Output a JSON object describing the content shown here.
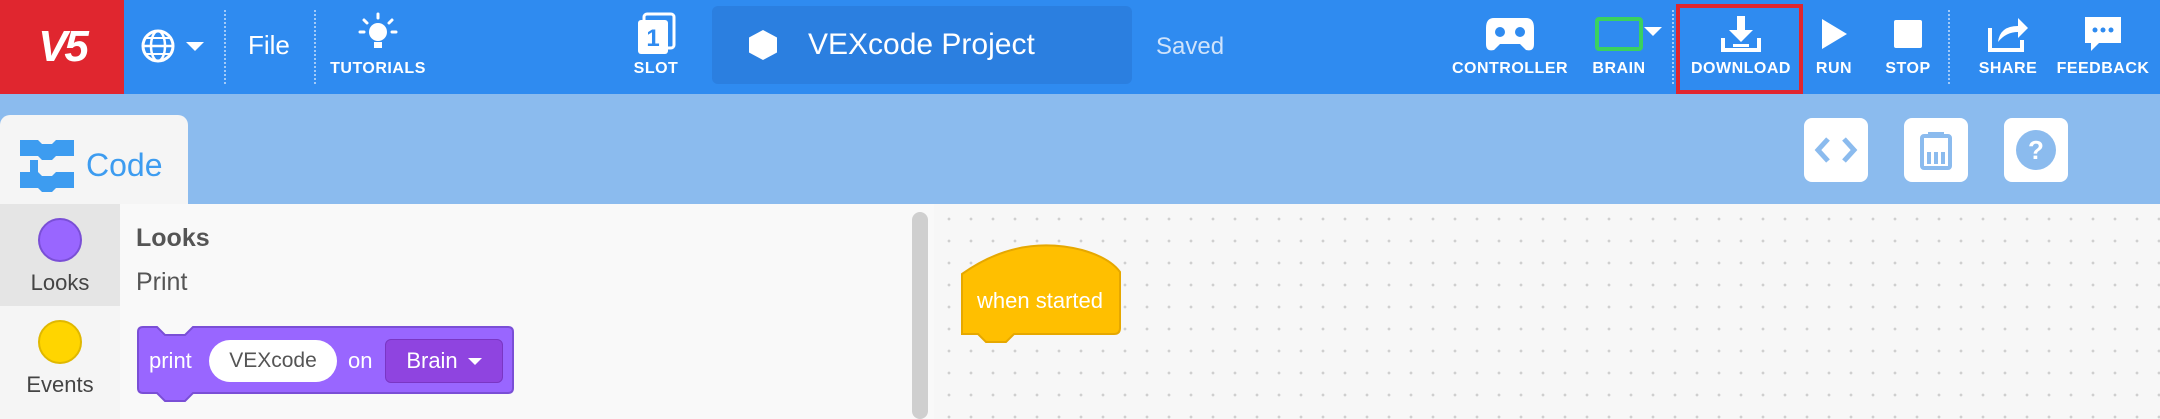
{
  "header": {
    "logo_text": "V5",
    "file_label": "File",
    "tutorials_label": "TUTORIALS",
    "slot_label": "SLOT",
    "slot_number": "1",
    "project_name": "VEXcode Project",
    "status": "Saved",
    "controller_label": "CONTROLLER",
    "brain_label": "BRAIN",
    "download_label": "DOWNLOAD",
    "run_label": "RUN",
    "stop_label": "STOP",
    "share_label": "SHARE",
    "feedback_label": "FEEDBACK"
  },
  "code_tab": {
    "label": "Code"
  },
  "categories": [
    {
      "label": "Looks",
      "color": "#9966ff"
    },
    {
      "label": "Events",
      "color": "#ffd500"
    }
  ],
  "palette": {
    "title": "Looks",
    "subtitle": "Print",
    "print_block": {
      "print": "print",
      "value": "VEXcode",
      "on": "on",
      "device": "Brain"
    }
  },
  "workspace": {
    "hat_block": "when started"
  },
  "colors": {
    "topbar": "#2f8bf0",
    "logo": "#e0262f",
    "band": "#8bbbee",
    "looks_block": "#9966ff",
    "events_block": "#ffbf00",
    "highlight": "#e0262f"
  },
  "icons": [
    "globe-icon",
    "lightbulb-icon",
    "slot-icon",
    "hexagon-icon",
    "controller-icon",
    "brain-icon",
    "download-icon",
    "run-icon",
    "stop-icon",
    "share-icon",
    "feedback-icon",
    "code-blocks-icon",
    "text-code-icon",
    "device-icon",
    "help-icon"
  ]
}
